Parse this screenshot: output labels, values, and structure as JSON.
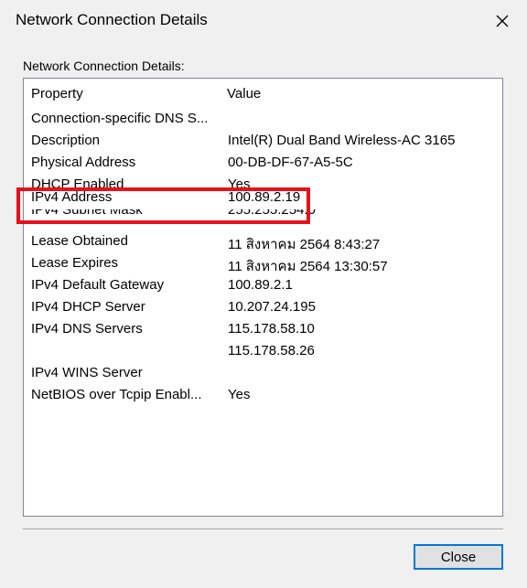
{
  "window": {
    "title": "Network Connection Details",
    "close_icon": "close-icon"
  },
  "group_label": "Network Connection Details:",
  "columns": {
    "property": "Property",
    "value": "Value"
  },
  "rows": [
    {
      "property": "Connection-specific DNS S...",
      "value": ""
    },
    {
      "property": "Description",
      "value": "Intel(R) Dual Band Wireless-AC 3165"
    },
    {
      "property": "Physical Address",
      "value": "00-DB-DF-67-A5-5C"
    },
    {
      "property": "DHCP Enabled",
      "value": "Yes"
    },
    {
      "property": "IPv4 Address",
      "value": "100.89.2.19"
    },
    {
      "property": "IPv4 Subnet Mask",
      "value": "255.255.254.0"
    },
    {
      "property": "Lease Obtained",
      "value": "11 สิงหาคม 2564 8:43:27"
    },
    {
      "property": "Lease Expires",
      "value": "11 สิงหาคม 2564 13:30:57"
    },
    {
      "property": "IPv4 Default Gateway",
      "value": "100.89.2.1"
    },
    {
      "property": "IPv4 DHCP Server",
      "value": "10.207.24.195"
    },
    {
      "property": "IPv4 DNS Servers",
      "value": "115.178.58.10"
    },
    {
      "property": "",
      "value": "115.178.58.26"
    },
    {
      "property": "IPv4 WINS Server",
      "value": ""
    },
    {
      "property": "NetBIOS over Tcpip Enabl...",
      "value": "Yes"
    }
  ],
  "highlight_color": "#e8101a",
  "buttons": {
    "close": "Close"
  }
}
